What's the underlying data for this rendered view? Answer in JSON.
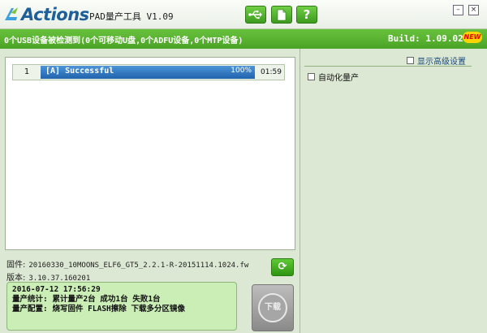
{
  "window": {
    "logo_text": "Actions",
    "app_title": "PAD量产工具 V1.09",
    "toolbar": [
      {
        "name": "usb-icon",
        "glyph": "⭠"
      },
      {
        "name": "document-icon",
        "glyph": "▯"
      },
      {
        "name": "help-icon",
        "glyph": "?"
      }
    ],
    "minimize_glyph": "–",
    "close_glyph": "×"
  },
  "status": {
    "summary": "0个USB设备被检测到(0个可移动U盘,0个ADFU设备,0个MTP设备)",
    "build": "Build: 1.09.02",
    "new_badge": "NEW"
  },
  "devices": [
    {
      "index": "1",
      "status": "[A] Successful",
      "percent_text": "100%",
      "progress": 1.0,
      "time": "01:59"
    }
  ],
  "firmware": {
    "label": "固件:",
    "value": "20160330_10MOONS_ELF6_GT5_2.2.1-R-20151114.1024.fw",
    "version_label": "版本:",
    "version_value": "3.10.37.160201"
  },
  "refresh_glyph": "⟳",
  "log": {
    "line1": "2016-07-12 17:56:29",
    "line2": "量产统计: 累计量产2台 成功1台 失败1台",
    "line3": "量产配置: 烧写固件 FLASH擦除 下载多分区镜像"
  },
  "download_button": {
    "label": "下载"
  },
  "right": {
    "advanced_label": "显示高级设置",
    "auto_label": "自动化量产"
  }
}
